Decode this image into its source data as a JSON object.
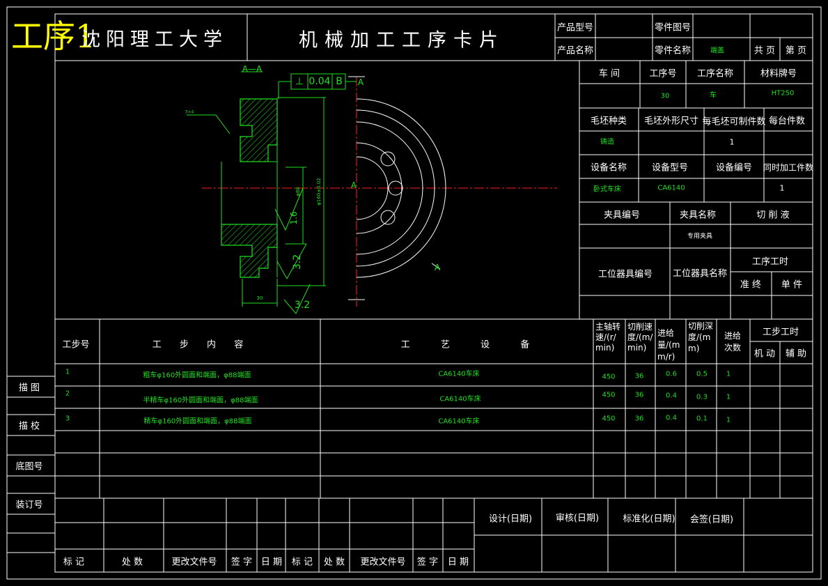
{
  "stamp": "工序1",
  "header": {
    "university": "沈阳理工大学",
    "card_title": "机械加工工序卡片",
    "product_model_label": "产品型号",
    "part_drawing_no_label": "零件图号",
    "product_name_label": "产品名称",
    "part_name_label": "零件名称",
    "part_name_value": "端盖",
    "total_pages_label": "共 页",
    "page_label": "第 页"
  },
  "process_info": {
    "workshop_label": "车 间",
    "op_no_label": "工序号",
    "op_name_label": "工序名称",
    "material_label": "材料牌号",
    "op_no_value": "30",
    "op_name_value": "车",
    "material_value": "HT250",
    "blank_type_label": "毛坯种类",
    "blank_size_label": "毛坯外形尺寸",
    "parts_per_blank_label": "每毛坯可制件数",
    "parts_per_unit_label": "每台件数",
    "blank_type_value": "铸造",
    "parts_per_blank_value": "1",
    "equip_name_label": "设备名称",
    "equip_model_label": "设备型号",
    "equip_no_label": "设备编号",
    "simul_parts_label": "同时加工件数",
    "equip_name_value": "卧式车床",
    "equip_model_value": "CA6140",
    "simul_parts_value": "1",
    "fixture_no_label": "夹具编号",
    "fixture_name_label": "夹具名称",
    "coolant_label": "切 削 液",
    "fixture_name_value": "专用夹具",
    "station_tool_no_label": "工位器具编号",
    "station_tool_name_label": "工位器具名称",
    "op_time_label": "工序工时",
    "prep_label": "准 终",
    "unit_label": "单 件"
  },
  "drawing": {
    "section_label": "A—A",
    "tolerance_value": "0.04",
    "datum": "B",
    "roughness_1": "1.6",
    "roughness_2": "3.2",
    "roughness_3": "3.2",
    "dim_bottom": "30",
    "dim_1": "φ88",
    "dim_2": "φ160±0.02",
    "marker_a": "A",
    "leader_text": "3×4"
  },
  "steps_table": {
    "headers": {
      "step_no": "工步号",
      "content": "工 步 内 容",
      "equipment": "工 艺 设 备",
      "spindle": "主轴转速/(r/min)",
      "speed": "切削速度/(m/min)",
      "feed": "进给量/(mm/r)",
      "depth": "切削深度/(mm)",
      "passes": "进给次数",
      "step_time": "工步工时",
      "machine": "机 动",
      "aux": "辅 助"
    },
    "rows": [
      {
        "no": "1",
        "content": "粗车φ160外圆面和端面，φ88端面",
        "equipment": "CA6140车床",
        "spindle": "450",
        "speed": "36",
        "feed": "0.6",
        "depth": "0.5",
        "passes": "1"
      },
      {
        "no": "2",
        "content": "半精车φ160外圆面和端面，φ88端面",
        "equipment": "CA6140车床",
        "spindle": "450",
        "speed": "36",
        "feed": "0.4",
        "depth": "0.3",
        "passes": "1"
      },
      {
        "no": "3",
        "content": "精车φ160外圆面和端面，φ88端面",
        "equipment": "CA6140车床",
        "spindle": "450",
        "speed": "36",
        "feed": "0.4",
        "depth": "0.1",
        "passes": "1"
      }
    ]
  },
  "side_labels": {
    "trace": "描 图",
    "check": "描 校",
    "base_no": "底图号",
    "binding_no": "装订号"
  },
  "footer": {
    "mark": "标 记",
    "count": "处 数",
    "change_doc": "更改文件号",
    "sign": "签 字",
    "date": "日 期",
    "design": "设计(日期)",
    "review": "审核(日期)",
    "standard": "标准化(日期)",
    "countersign": "会签(日期)"
  },
  "colors": {
    "line": "#ffffff",
    "green": "#1ee01e",
    "red": "#ff2020",
    "stamp": "#ffff00"
  }
}
